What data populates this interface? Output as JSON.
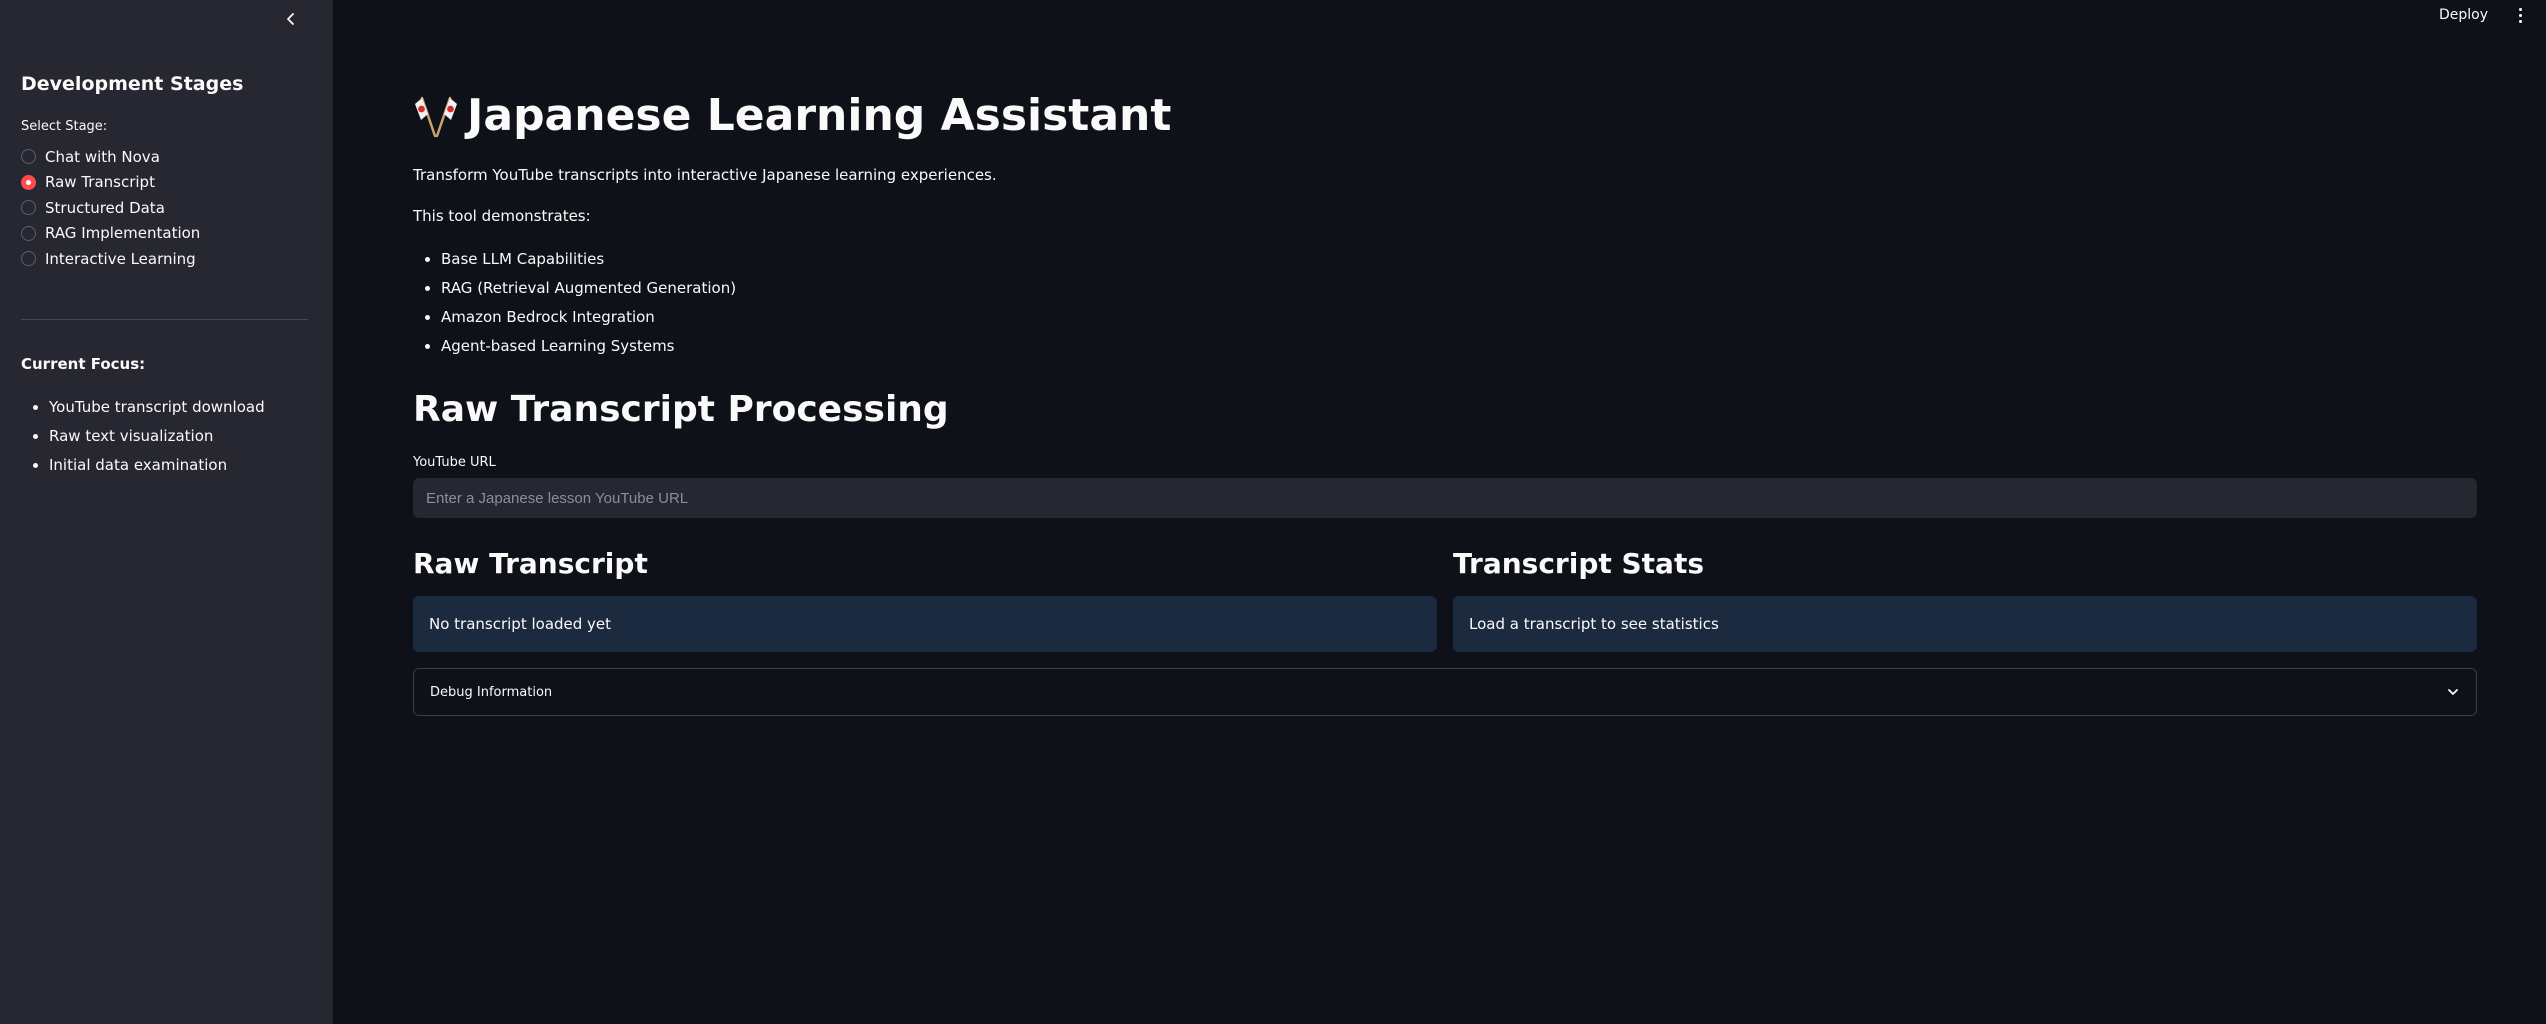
{
  "sidebar": {
    "heading": "Development Stages",
    "select_label": "Select Stage:",
    "stages": [
      {
        "label": "Chat with Nova",
        "selected": false
      },
      {
        "label": "Raw Transcript",
        "selected": true
      },
      {
        "label": "Structured Data",
        "selected": false
      },
      {
        "label": "RAG Implementation",
        "selected": false
      },
      {
        "label": "Interactive Learning",
        "selected": false
      }
    ],
    "focus_heading": "Current Focus:",
    "focus_items": [
      "YouTube transcript download",
      "Raw text visualization",
      "Initial data examination"
    ]
  },
  "topbar": {
    "deploy_label": "Deploy",
    "menu_icon": "vertical-dots-icon"
  },
  "main": {
    "title": "Japanese Learning Assistant",
    "title_icon": "crossed-flags-icon",
    "intro": "Transform YouTube transcripts into interactive Japanese learning experiences.",
    "demo_heading": "This tool demonstrates:",
    "features": [
      "Base LLM Capabilities",
      "RAG (Retrieval Augmented Generation)",
      "Amazon Bedrock Integration",
      "Agent-based Learning Systems"
    ],
    "section_title": "Raw Transcript Processing",
    "url_label": "YouTube URL",
    "url_value": "",
    "url_placeholder": "Enter a Japanese lesson YouTube URL",
    "raw_title": "Raw Transcript",
    "raw_info": "No transcript loaded yet",
    "stats_title": "Transcript Stats",
    "stats_info": "Load a transcript to see statistics",
    "debug_label": "Debug Information"
  },
  "colors": {
    "background": "#0e1117",
    "sidebar": "#262730",
    "accent": "#ff4b4b",
    "info_box": "#1c2a3f"
  }
}
